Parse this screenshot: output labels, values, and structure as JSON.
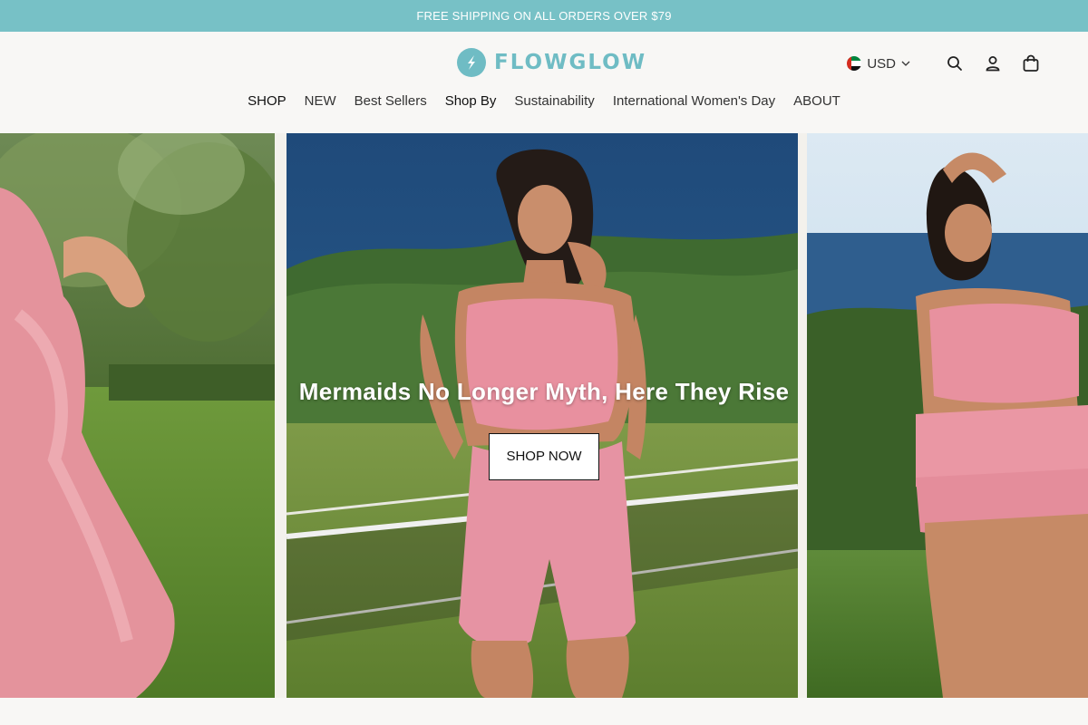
{
  "announcement": "FREE SHIPPING ON ALL ORDERS OVER $79",
  "brand": {
    "name": "FLOWGLOW",
    "color": "#6fbcc4"
  },
  "header_utils": {
    "currency": "USD",
    "flag_icon": "uae-flag-icon",
    "icons": [
      "search-icon",
      "account-icon",
      "cart-icon"
    ]
  },
  "nav": {
    "items": [
      "SHOP",
      "NEW",
      "Best Sellers",
      "Shop By",
      "Sustainability",
      "International Women's Day",
      "ABOUT"
    ]
  },
  "hero": {
    "title": "Mermaids No Longer Myth, Here They Rise",
    "cta": "SHOP NOW"
  },
  "colors": {
    "announcement_bg": "#77c1c6",
    "page_bg": "#f8f7f5",
    "accent_pink": "#e88fa6"
  }
}
